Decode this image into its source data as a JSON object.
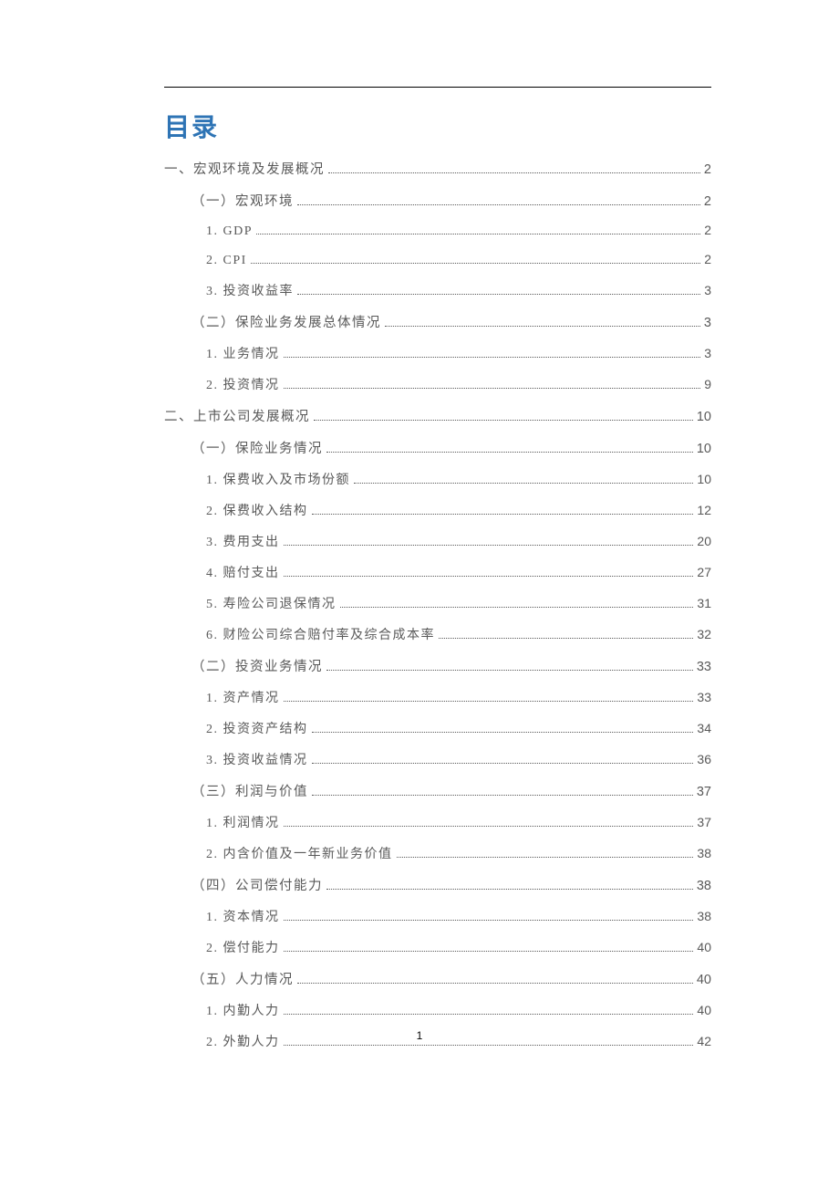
{
  "title": "目录",
  "page_number": "1",
  "toc": [
    {
      "level": 0,
      "label": "一、宏观环境及发展概况",
      "page": "2"
    },
    {
      "level": 1,
      "label": "（一）宏观环境",
      "page": "2"
    },
    {
      "level": 2,
      "label": "1. GDP",
      "page": "2"
    },
    {
      "level": 2,
      "label": "2. CPI",
      "page": "2"
    },
    {
      "level": 2,
      "label": "3. 投资收益率",
      "page": "3"
    },
    {
      "level": 1,
      "label": "（二）保险业务发展总体情况",
      "page": "3"
    },
    {
      "level": 2,
      "label": "1. 业务情况",
      "page": "3"
    },
    {
      "level": 2,
      "label": "2. 投资情况",
      "page": "9"
    },
    {
      "level": 0,
      "label": "二、上市公司发展概况",
      "page": "10"
    },
    {
      "level": 1,
      "label": "（一）保险业务情况",
      "page": "10"
    },
    {
      "level": 2,
      "label": "1. 保费收入及市场份额",
      "page": "10"
    },
    {
      "level": 2,
      "label": "2. 保费收入结构",
      "page": "12"
    },
    {
      "level": 2,
      "label": "3. 费用支出",
      "page": "20"
    },
    {
      "level": 2,
      "label": "4. 赔付支出",
      "page": "27"
    },
    {
      "level": 2,
      "label": "5. 寿险公司退保情况",
      "page": "31"
    },
    {
      "level": 2,
      "label": "6. 财险公司综合赔付率及综合成本率",
      "page": "32"
    },
    {
      "level": 1,
      "label": "（二）投资业务情况",
      "page": "33"
    },
    {
      "level": 2,
      "label": "1. 资产情况",
      "page": "33"
    },
    {
      "level": 2,
      "label": "2. 投资资产结构",
      "page": "34"
    },
    {
      "level": 2,
      "label": "3. 投资收益情况",
      "page": "36"
    },
    {
      "level": 1,
      "label": "（三）利润与价值",
      "page": "37"
    },
    {
      "level": 2,
      "label": "1. 利润情况",
      "page": "37"
    },
    {
      "level": 2,
      "label": "2. 内含价值及一年新业务价值",
      "page": "38"
    },
    {
      "level": 1,
      "label": "（四）公司偿付能力",
      "page": "38"
    },
    {
      "level": 2,
      "label": "1. 资本情况",
      "page": "38"
    },
    {
      "level": 2,
      "label": "2. 偿付能力",
      "page": "40"
    },
    {
      "level": 1,
      "label": "（五）人力情况",
      "page": "40"
    },
    {
      "level": 2,
      "label": "1. 内勤人力",
      "page": "40"
    },
    {
      "level": 2,
      "label": "2. 外勤人力",
      "page": "42"
    }
  ]
}
